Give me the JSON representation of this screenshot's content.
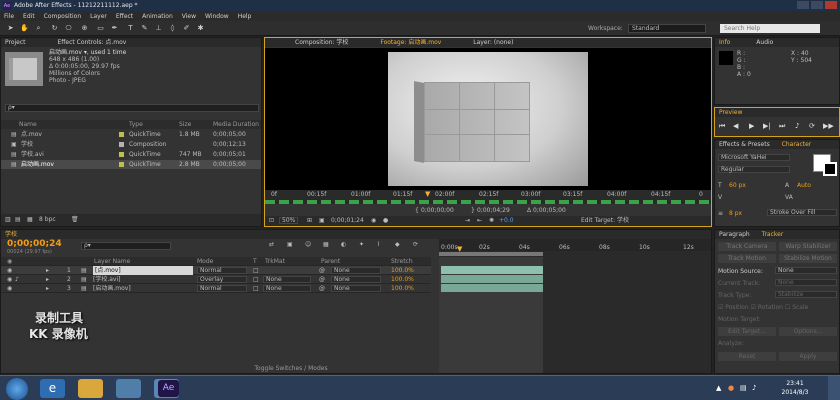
{
  "window": {
    "title": "Adobe After Effects - 11212211112.aep *",
    "app_icon": "Ae"
  },
  "menu": [
    "File",
    "Edit",
    "Composition",
    "Layer",
    "Effect",
    "Animation",
    "View",
    "Window",
    "Help"
  ],
  "toolbar": {
    "workspace_label": "Workspace:",
    "workspace_value": "Standard",
    "help_placeholder": "Search Help"
  },
  "project": {
    "tab_project": "Project",
    "tab_effects": "Effect Controls: 点.mov",
    "file_name": "启动画.mov ▾, used 1 time",
    "file_info": [
      "648 x 486 (1.00)",
      "Δ 0:00:05:00, 29.97 fps",
      "Millions of Colors",
      "Photo - JPEG"
    ],
    "search_placeholder": "ρ▾",
    "columns": {
      "name": "Name",
      "type": "Type",
      "size": "Size",
      "duration": "Media Duration"
    },
    "items": [
      {
        "name": "点.mov",
        "type": "QuickTime",
        "size": "1.8 MB",
        "duration": "0;00;05;00",
        "color": "#bfbf4f"
      },
      {
        "name": "学校",
        "type": "Composition",
        "size": "",
        "duration": "0;00;12;13",
        "color": "#b3b3b3"
      },
      {
        "name": "学校.avi",
        "type": "QuickTime",
        "size": "747 MB",
        "duration": "0;00;05;01",
        "color": "#bfbf4f"
      },
      {
        "name": "启动画.mov",
        "type": "QuickTime",
        "size": "2.8 MB",
        "duration": "0;00;05;00",
        "color": "#bfbf4f"
      }
    ],
    "bpc": "8 bpc"
  },
  "viewer": {
    "tab_comp": "Composition: 学校",
    "tab_footage": "Footage: 启动画.mov",
    "tab_layer": "Layer: (none)",
    "ruler": [
      "0f",
      "00:15f",
      "01:00f",
      "01:15f",
      "02:00f",
      "02:15f",
      "03:00f",
      "03:15f",
      "04:00f",
      "04:15f",
      "0"
    ],
    "zoom": "50%",
    "timecode": "0;00;01;24",
    "in_point": "0;00;00;00",
    "out_point": "0;00;04;29",
    "duration": "Δ 0;00;05;00",
    "fps_label": "+0.0",
    "edit_target": "Edit Target: 学校"
  },
  "info_panel": {
    "tab_info": "Info",
    "tab_audio": "Audio",
    "rows": [
      "R :",
      "G :",
      "B :",
      "A : 0"
    ],
    "coords": [
      "X : 40",
      "Y : 504"
    ]
  },
  "preview": {
    "tab": "Preview"
  },
  "character": {
    "tab_effects": "Effects & Presets",
    "tab_character": "Character",
    "font": "Microsoft YaHei",
    "style": "Regular",
    "size": "60 px",
    "leading": "Auto",
    "stroke_size": "8 px",
    "stroke_mode": "Stroke Over Fill"
  },
  "tracker": {
    "tab_paragraph": "Paragraph",
    "tab_tracker": "Tracker",
    "buttons": [
      "Track Camera",
      "Warp Stabilizer",
      "Track Motion",
      "Stabilize Motion"
    ],
    "motion_source_label": "Motion Source:",
    "motion_source_value": "None",
    "current_track_label": "Current Track:",
    "current_track_value": "None",
    "track_type_label": "Track Type:",
    "track_type_value": "Stabilize",
    "checks": [
      "Position",
      "Rotation",
      "Scale"
    ],
    "motion_target_label": "Motion Target:",
    "edit_target": "Edit Target...",
    "options": "Options...",
    "analyze": "Analyze:",
    "reset": "Reset",
    "apply": "Apply"
  },
  "timeline": {
    "tab": "学校",
    "timecode": "0;00;00;24",
    "timecode_sub": "00024 (29.97 fps)",
    "search_placeholder": "ρ▾",
    "columns": {
      "layer_name": "Layer Name",
      "mode": "Mode",
      "t": "T",
      "trkmat": "TrkMat",
      "parent": "Parent",
      "stretch": "Stretch"
    },
    "layers": [
      {
        "num": "1",
        "name": "[点.mov]",
        "mode": "Normal",
        "trkmat": "",
        "parent": "None",
        "stretch": "100.0%"
      },
      {
        "num": "2",
        "name": "[学校.avi]",
        "mode": "Overlay",
        "trkmat": "None",
        "parent": "None",
        "stretch": "100.0%"
      },
      {
        "num": "3",
        "name": "[启动画.mov]",
        "mode": "Normal",
        "trkmat": "None",
        "parent": "None",
        "stretch": "100.0%"
      }
    ],
    "ruler": [
      "0:00s",
      "02s",
      "04s",
      "06s",
      "08s",
      "10s",
      "12s"
    ],
    "toggle_label": "Toggle Switches / Modes"
  },
  "watermark": {
    "line1": "录制工具",
    "line2": "KK 录像机"
  },
  "taskbar": {
    "time": "23:41",
    "date": "2014/8/3",
    "ae_label": "Ae"
  }
}
